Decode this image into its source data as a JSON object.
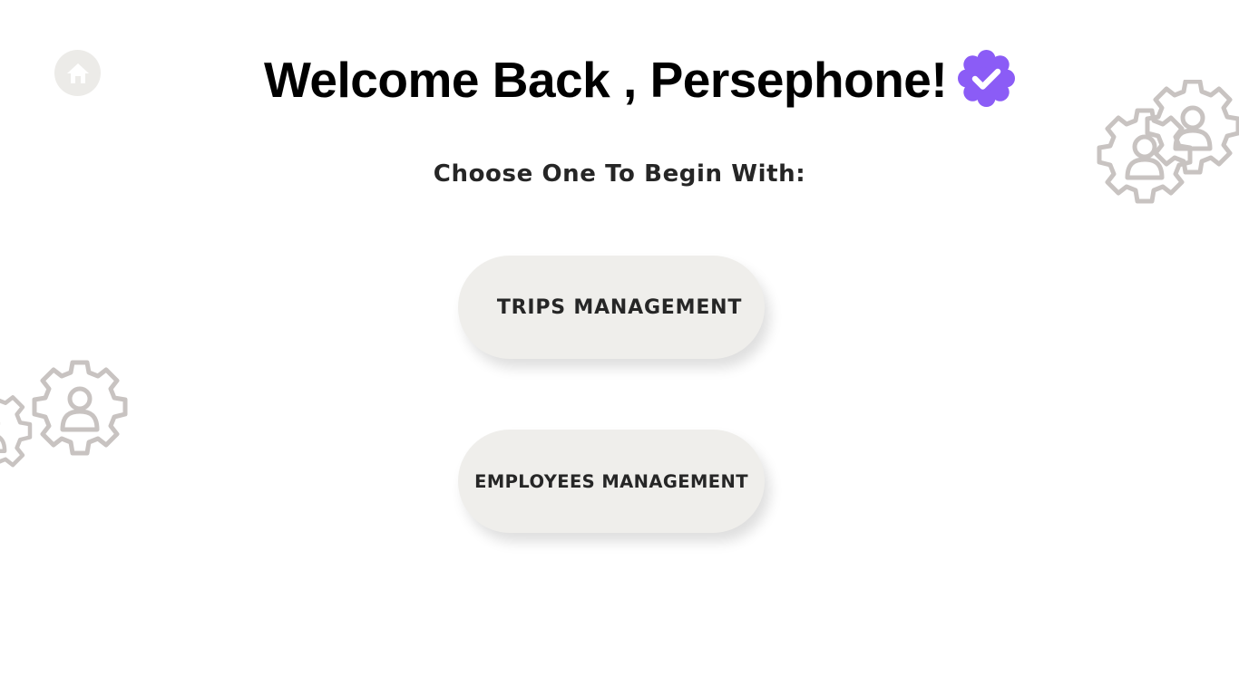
{
  "header": {
    "title": "Welcome Back , Persephone!",
    "home_icon": "home-icon",
    "badge_icon": "verified-check-icon"
  },
  "main": {
    "prompt": "Choose One To Begin With:",
    "options": [
      {
        "label": "TRIPS MANAGEMENT"
      },
      {
        "label": "EMPLOYEES MANAGEMENT"
      }
    ]
  },
  "decorations": {
    "icon": "gear-user-icon"
  },
  "colors": {
    "background": "#ffffff",
    "button_bg": "#efeeeb",
    "text_dark": "#262626",
    "badge": "#8b5cf6",
    "gear": "#c8c3c1",
    "home_bg": "#ecebe8"
  }
}
